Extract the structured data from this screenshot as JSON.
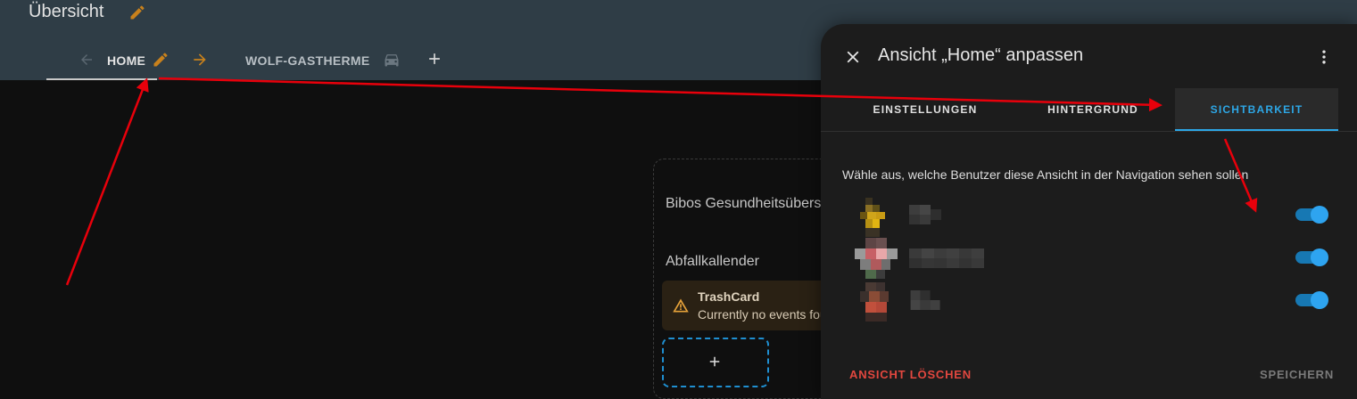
{
  "app": {
    "title": "Übersicht"
  },
  "tabs": [
    {
      "label": "HOME"
    },
    {
      "label": "WOLF-GASTHERME"
    }
  ],
  "dashboard": {
    "cards": [
      {
        "title": "Bibos Gesundheitsübersicht"
      },
      {
        "title": "Abfallkallender"
      }
    ],
    "trash_card": {
      "title": "TrashCard",
      "message": "Currently no events found"
    }
  },
  "dialog": {
    "title": "Ansicht „Home“ anpassen",
    "tabs": [
      "EINSTELLUNGEN",
      "HINTERGRUND",
      "SICHTBARKEIT"
    ],
    "active_tab": "SICHTBARKEIT",
    "description": "Wähle aus, welche Benutzer diese Ansicht in der Navigation sehen sollen",
    "users": [
      {
        "visible": true
      },
      {
        "visible": true
      },
      {
        "visible": true
      }
    ],
    "delete_label": "ANSICHT LÖSCHEN",
    "save_label": "SPEICHERN"
  },
  "colors": {
    "header_bg": "#2f3d46",
    "accent": "#2da7e6",
    "edit_icon": "#c8811c",
    "delete": "#e2473f",
    "annotation_arrow": "#e8000b"
  }
}
